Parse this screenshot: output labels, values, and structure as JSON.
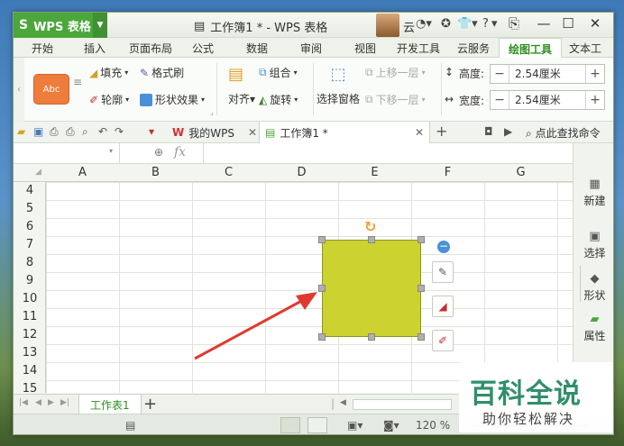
{
  "app": {
    "name": "WPS 表格",
    "document_title": "工作簿1 * - WPS 表格",
    "user_name": "云",
    "help_glyph": "?"
  },
  "ribbon_tabs": [
    "开始",
    "插入",
    "页面布局",
    "公式",
    "数据",
    "审阅",
    "视图",
    "开发工具",
    "云服务",
    "绘图工具",
    "文本工"
  ],
  "active_tab": "绘图工具",
  "ribbon": {
    "style_preview": "Abc",
    "fill": "填充",
    "format_painter": "格式刷",
    "outline": "轮廓",
    "shape_effects": "形状效果",
    "align": "对齐",
    "group": "组合",
    "rotate": "旋转",
    "selection_pane": "选择窗格",
    "bring_forward": "上移一层",
    "send_backward": "下移一层",
    "height_label": "高度:",
    "height_value": "2.54厘米",
    "width_label": "宽度:",
    "width_value": "2.54厘米"
  },
  "quick_access": {
    "mywps_tab": "我的WPS",
    "doc_tab": "工作簿1 *",
    "search_command": "点此查找命令"
  },
  "formula_bar": {
    "name_box": "",
    "fx": "fx",
    "formula": ""
  },
  "columns": [
    "A",
    "B",
    "C",
    "D",
    "E",
    "F",
    "G"
  ],
  "rows": [
    "4",
    "5",
    "6",
    "7",
    "8",
    "9",
    "10",
    "11",
    "12",
    "13",
    "14",
    "15"
  ],
  "task_pane": [
    "新建",
    "选择",
    "形状",
    "属性"
  ],
  "sheet_tabs": [
    "工作表1"
  ],
  "status": {
    "zoom": "120 %"
  },
  "shape": {
    "fill_color": "#ccd230",
    "arrow_color": "#e03a2e"
  },
  "watermark": {
    "title": "百科全说",
    "subtitle": "助你轻松解决"
  },
  "colors": {
    "brand_green": "#4ba63b",
    "style_orange": "#ee7d3b"
  }
}
